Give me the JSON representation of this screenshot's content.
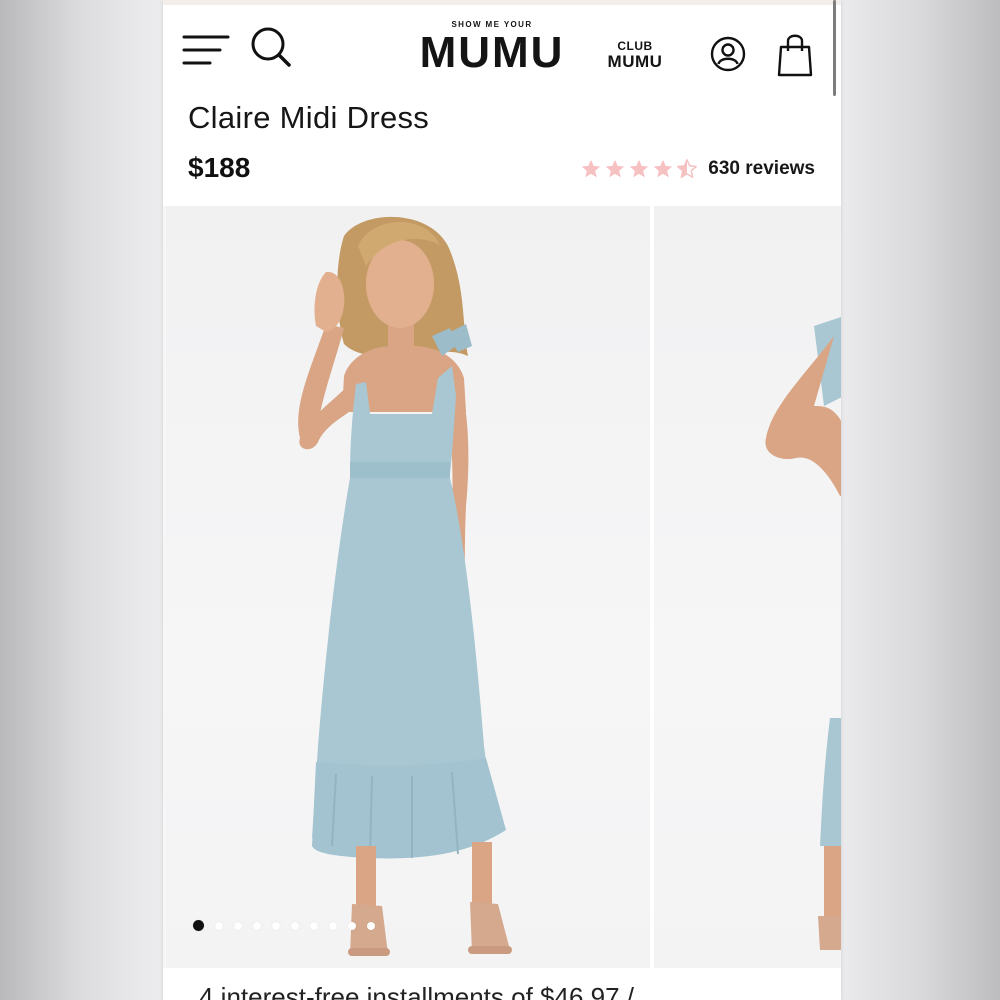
{
  "header": {
    "logo_small": "SHOW ME YOUR",
    "logo_big": "MUMU",
    "club_top": "CLUB",
    "club_bottom": "MUMU",
    "icons": [
      "menu-icon",
      "search-icon",
      "account-icon",
      "shopping-bag-icon"
    ]
  },
  "product": {
    "title": "Claire Midi Dress",
    "price": "$188",
    "rating": 4.5,
    "rating_max": 5,
    "reviews": "630 reviews"
  },
  "gallery": {
    "slide_count": 10,
    "active_index": 0,
    "images": [
      "model in light blue tie-strap midi dress, front view",
      "model in light blue dress, side view (partially visible)"
    ]
  },
  "colors": {
    "star": "#f5c1c1",
    "text": "#161616",
    "dress": "#a8c7d2",
    "skin": "#d9a585"
  },
  "afterpay_text": "4 interest-free installments of $46.97 /"
}
